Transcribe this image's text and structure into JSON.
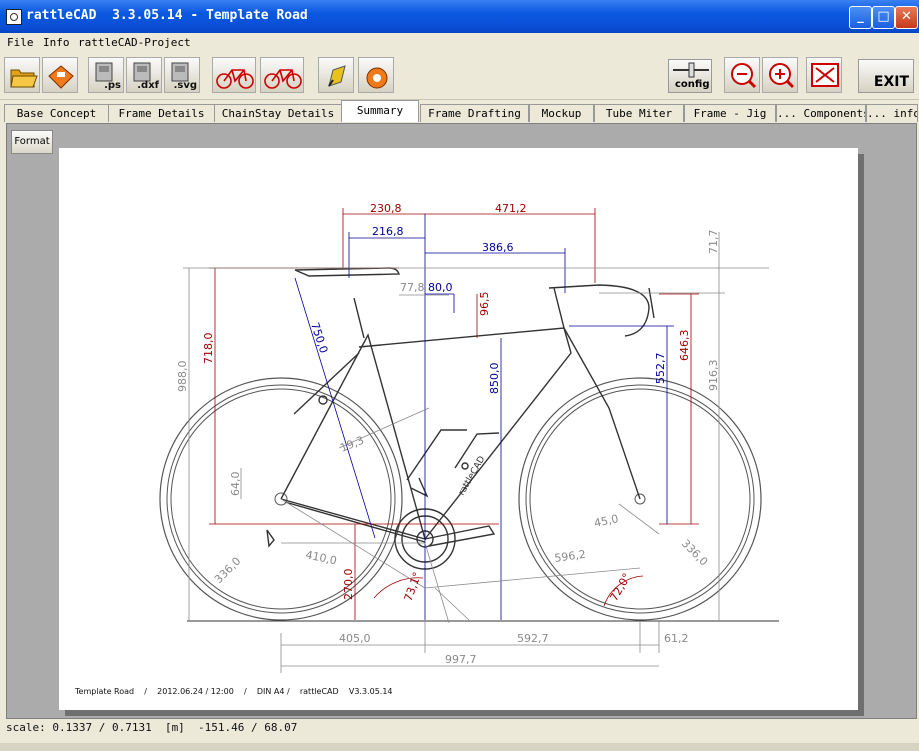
{
  "window": {
    "title": "rattleCAD  3.3.05.14 - Template Road",
    "minimize_glyph": "_",
    "maximize_glyph": "□",
    "close_glyph": "✕"
  },
  "menu": {
    "file": "File",
    "info": "Info",
    "project": "rattleCAD-Project"
  },
  "toolbar": {
    "ps_label": ".ps",
    "dxf_label": ".dxf",
    "svg_label": ".svg",
    "config_label": "config",
    "exit_label": "EXIT",
    "icons": [
      "open-folder-icon",
      "save-icon",
      "export-ps-icon",
      "export-dxf-icon",
      "export-svg-icon",
      "bike-reference-icon",
      "bike-compare-icon",
      "pen-icon",
      "bike-render-icon",
      "zoom-out-icon",
      "zoom-in-icon",
      "fit-icon"
    ]
  },
  "tabs": [
    "Base Concept",
    "Frame Details",
    "ChainStay Details",
    "Summary",
    "Frame Drafting",
    "Mockup",
    "Tube Miter",
    "Frame - Jig",
    "... Components",
    "... info"
  ],
  "active_tab": "Summary",
  "format_button": "Format",
  "drawing": {
    "dims": {
      "d230_8": "230,8",
      "d471_2": "471,2",
      "d216_8": "216,8",
      "d386_6": "386,6",
      "d71_7": "71,7",
      "d77_8": "77,8",
      "d80_0": "80,0",
      "d96_5": "96,5",
      "d988_0": "988,0",
      "d718_0": "718,0",
      "d750_0": "750,0",
      "d850_0": "850,0",
      "d552_7": "552,7",
      "d646_3": "646,3",
      "d916_3": "916,3",
      "d64_0": "64,0",
      "d19_3": "19,3",
      "d45_0": "45,0",
      "d336_left": "336,0",
      "d336_right": "336,0",
      "d410_0": "410,0",
      "d596_2": "596,2",
      "d270_0": "270,0",
      "d73_1": "73,1°",
      "d72_0": "72,0°",
      "d405_0": "405,0",
      "d592_7": "592,7",
      "d61_2": "61,2",
      "d997_7": "997,7"
    },
    "brand": "rattleCAD",
    "footer": "Template Road    /    2012.06.24 / 12:00    /    DIN A4 /    rattleCAD    V3.3.05.14",
    "colors": {
      "red": "#a00000",
      "blue": "#000098",
      "gray": "#8a8a8a",
      "bike": "#333333"
    }
  },
  "status": "scale: 0.1337 / 0.7131  [m]  -151.46 / 68.07"
}
